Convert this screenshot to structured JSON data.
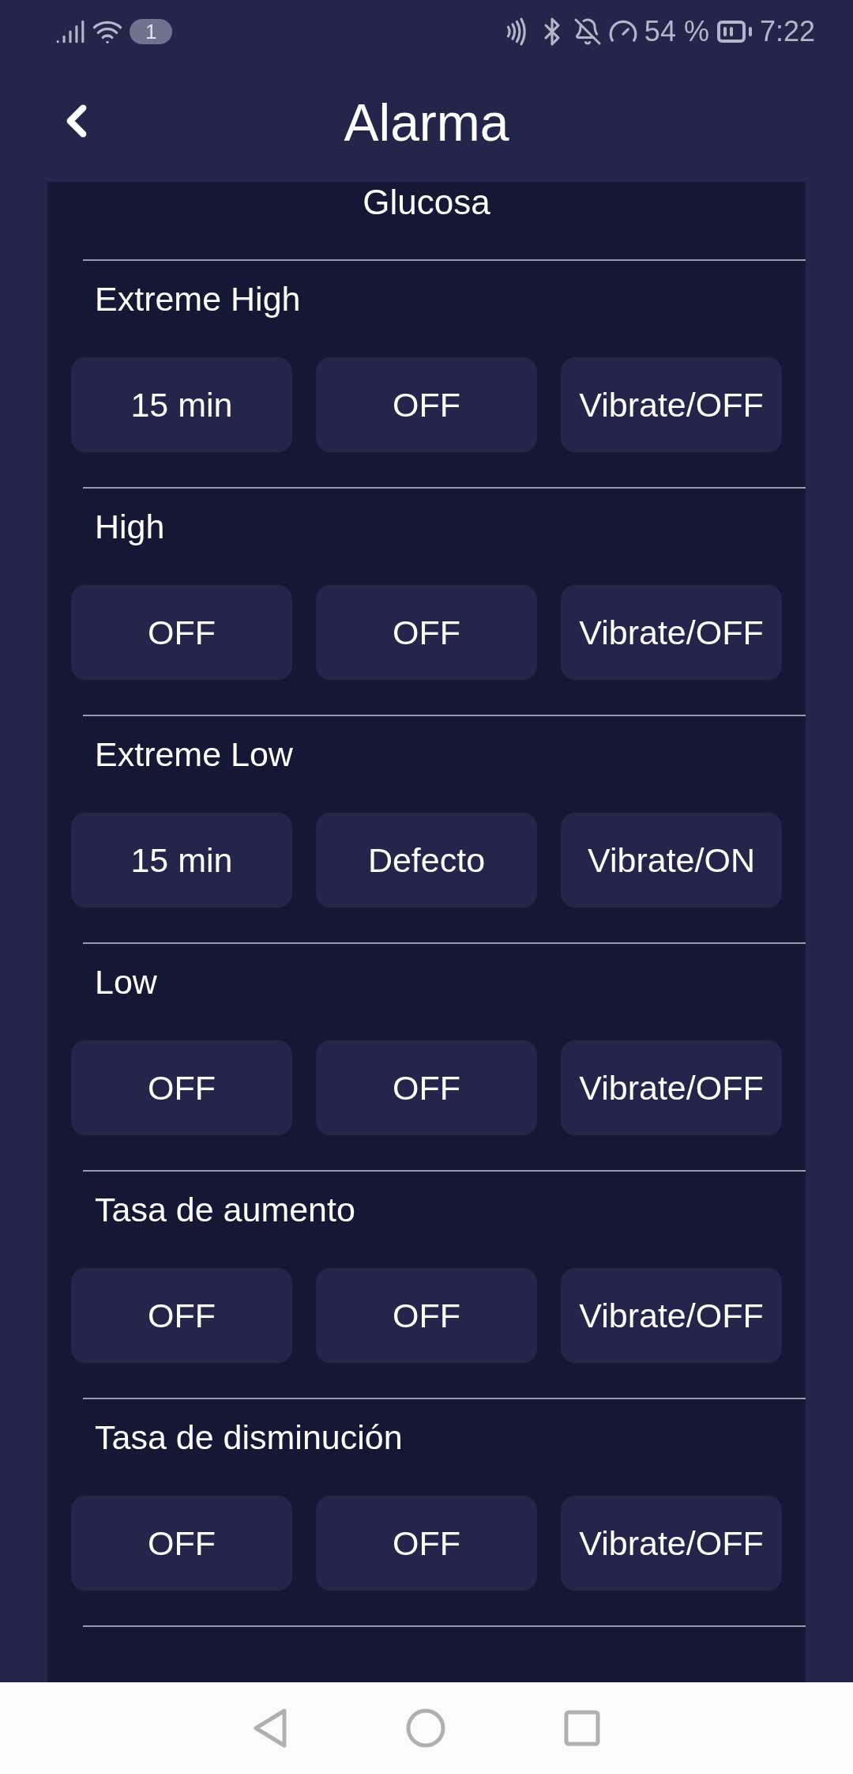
{
  "status_bar": {
    "notification_count": "1",
    "battery": "54 %",
    "time": "7:22"
  },
  "header": {
    "title": "Alarma"
  },
  "card": {
    "heading": "Glucosa",
    "sections": [
      {
        "label": "Extreme High",
        "options": [
          "15 min",
          "OFF",
          "Vibrate/OFF"
        ]
      },
      {
        "label": "High",
        "options": [
          "OFF",
          "OFF",
          "Vibrate/OFF"
        ]
      },
      {
        "label": "Extreme Low",
        "options": [
          "15 min",
          "Defecto",
          "Vibrate/ON"
        ]
      },
      {
        "label": "Low",
        "options": [
          "OFF",
          "OFF",
          "Vibrate/OFF"
        ]
      },
      {
        "label": "Tasa de aumento",
        "options": [
          "OFF",
          "OFF",
          "Vibrate/OFF"
        ]
      },
      {
        "label": "Tasa de disminución",
        "options": [
          "OFF",
          "OFF",
          "Vibrate/OFF"
        ]
      }
    ]
  }
}
